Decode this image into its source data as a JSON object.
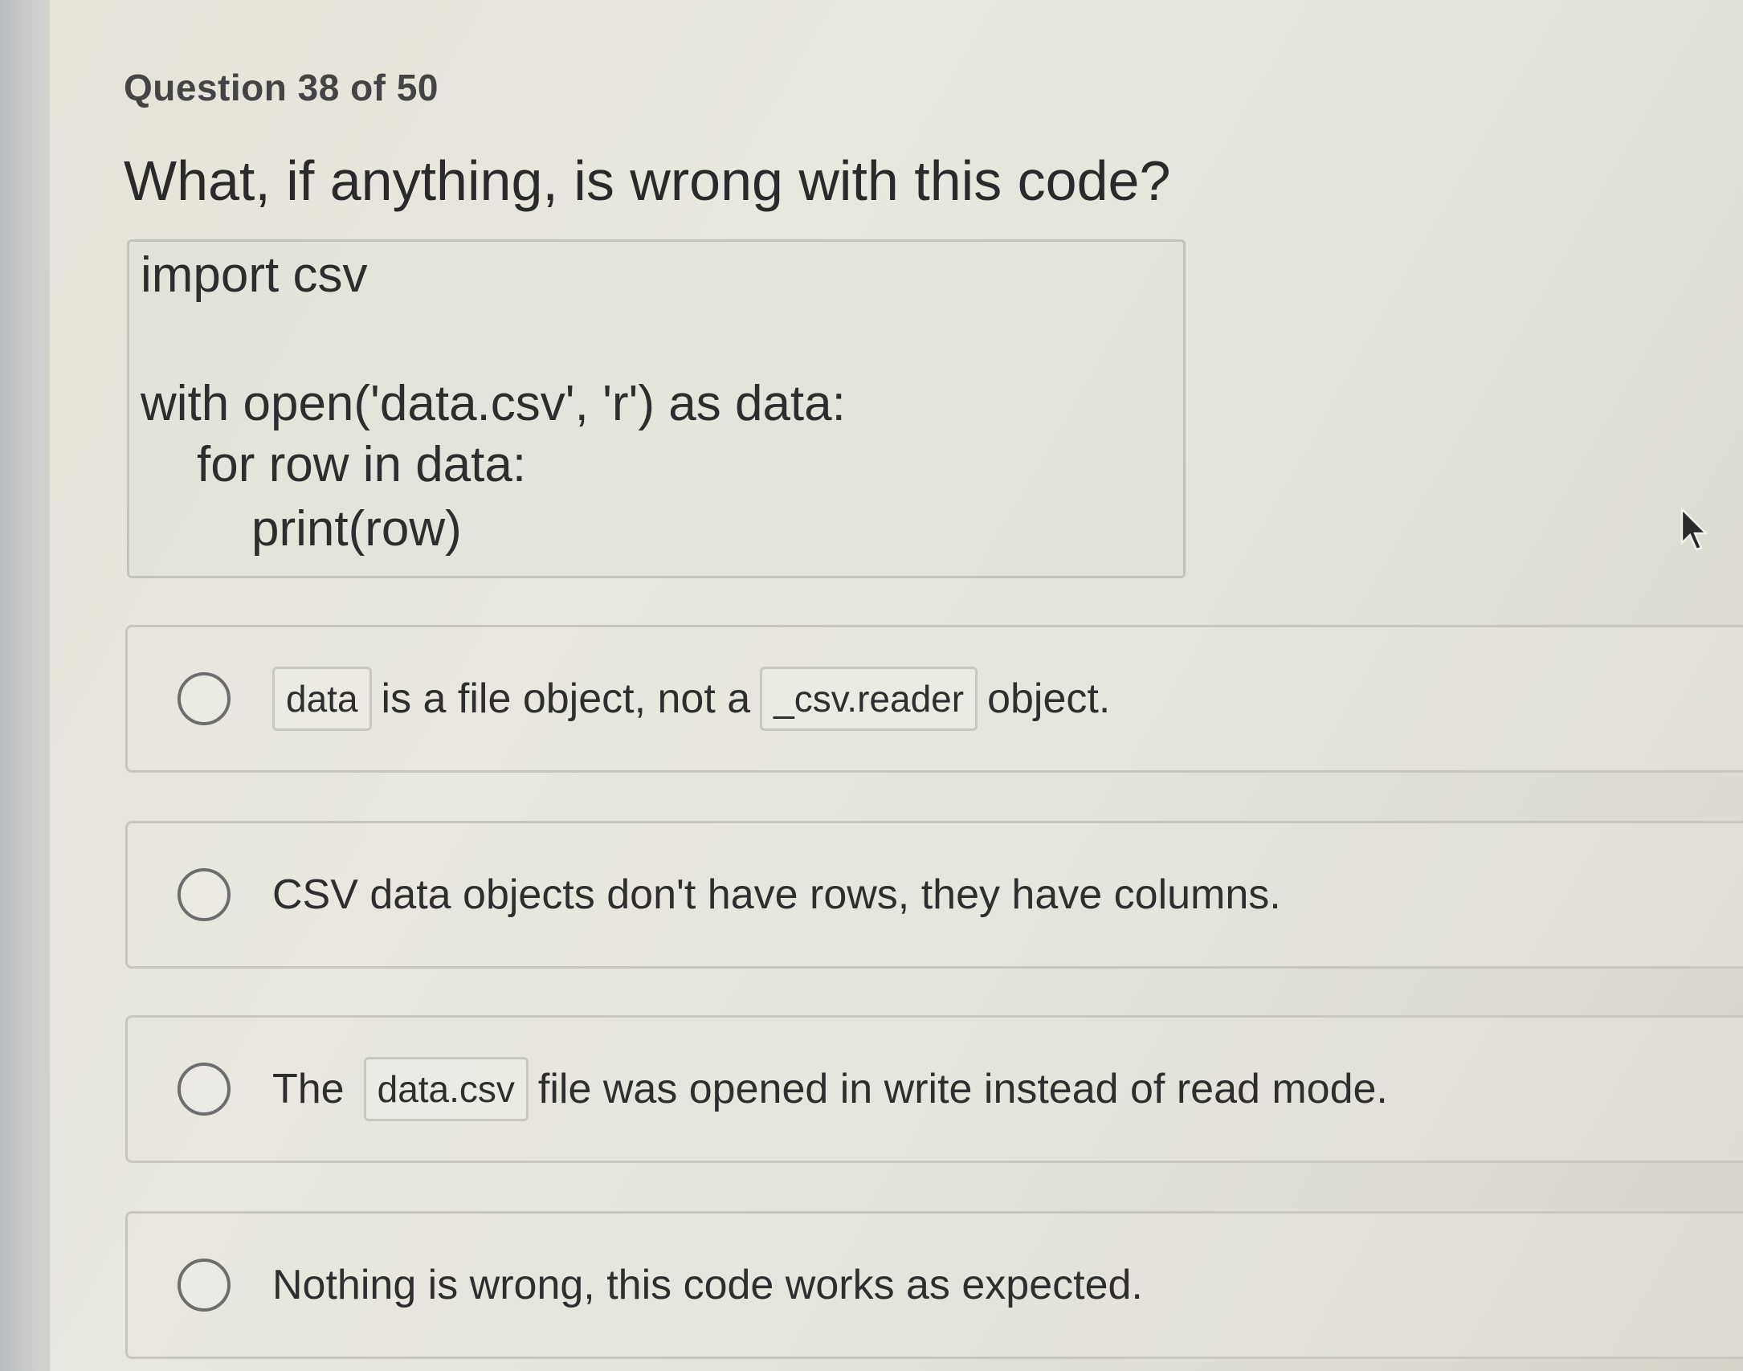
{
  "header": {
    "counter": "Question 38 of 50"
  },
  "question": {
    "text": "What, if anything, is wrong with this code?",
    "code_lines": [
      "import csv",
      "with open('data.csv', 'r') as data:",
      "for row in data:",
      "print(row)"
    ]
  },
  "choices": [
    {
      "chip1": "data",
      "text1": "is a file object, not a",
      "chip2": "_csv.reader",
      "text2": "object."
    },
    {
      "text": "CSV data objects don't have rows, they have columns."
    },
    {
      "text1": "The",
      "chip": "data.csv",
      "text2": "file was opened in write instead of read mode."
    },
    {
      "text": "Nothing is wrong, this code works as expected."
    }
  ],
  "icons": {
    "radio": "radio-button-icon",
    "cursor": "mouse-cursor-icon"
  },
  "colors": {
    "text": "#2e2e2e",
    "border": "#c8c7c0",
    "radio_border": "#6d6d6d"
  }
}
